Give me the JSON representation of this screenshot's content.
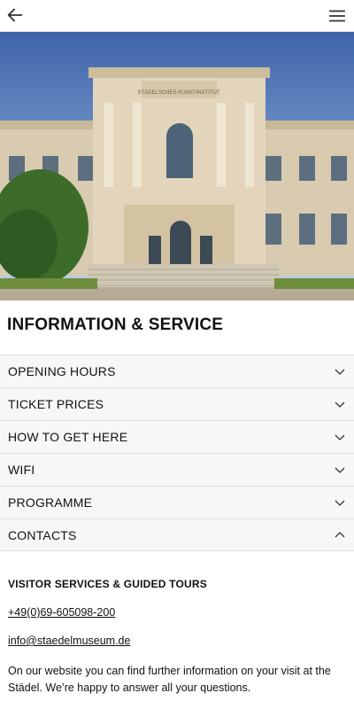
{
  "header": {
    "back_icon": "arrow-left-icon",
    "menu_icon": "hamburger-icon"
  },
  "hero": {
    "description_icon": "museum-building-image",
    "facade_inscription": "STÄDELSCHES KUNSTINSTITUT"
  },
  "page_title": "INFORMATION & SERVICE",
  "accordion": [
    {
      "label": "OPENING HOURS",
      "expanded": false
    },
    {
      "label": "TICKET PRICES",
      "expanded": false
    },
    {
      "label": "HOW TO GET HERE",
      "expanded": false
    },
    {
      "label": "WIFI",
      "expanded": false
    },
    {
      "label": "PROGRAMME",
      "expanded": false
    },
    {
      "label": "CONTACTS",
      "expanded": true
    }
  ],
  "contacts": {
    "heading": "VISITOR SERVICES & GUIDED TOURS",
    "phone": "+49(0)69-605098-200",
    "email": "info@staedelmuseum.de",
    "text": "On our website you can find further information on your visit at the Städel. We’re happy to answer all your questions."
  },
  "colors": {
    "row_bg": "#f7f7f7",
    "divider": "#dedede",
    "text": "#111111"
  }
}
